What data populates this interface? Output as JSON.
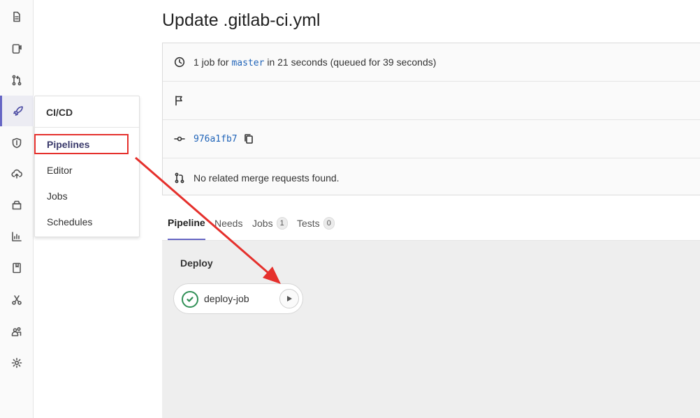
{
  "sidebar": {
    "icons": [
      {
        "name": "project-overview-icon",
        "label": ""
      },
      {
        "name": "issues-icon",
        "label": ""
      },
      {
        "name": "merge-requests-icon",
        "label": ""
      },
      {
        "name": "cicd-rocket-icon",
        "label": ""
      },
      {
        "name": "security-shield-icon",
        "label": ""
      },
      {
        "name": "deployments-icon",
        "label": ""
      },
      {
        "name": "packages-icon",
        "label": ""
      },
      {
        "name": "analytics-icon",
        "label": ""
      },
      {
        "name": "wiki-icon",
        "label": ""
      },
      {
        "name": "snippets-icon",
        "label": ""
      },
      {
        "name": "members-icon",
        "label": ""
      },
      {
        "name": "settings-gear-icon",
        "label": ""
      }
    ],
    "active": "cicd-rocket-icon"
  },
  "flyout": {
    "title": "CI/CD",
    "items": [
      "Pipelines",
      "Editor",
      "Jobs",
      "Schedules"
    ],
    "active_item": "Pipelines"
  },
  "page": {
    "title": "Update .gitlab-ci.yml"
  },
  "info": {
    "job_prefix": "1 job for",
    "branch": "master",
    "job_suffix": "in 21 seconds (queued for 39 seconds)",
    "commit_sha": "976a1fb7",
    "merge_requests": "No related merge requests found."
  },
  "tabs": [
    {
      "label": "Pipeline",
      "count": null,
      "active": true
    },
    {
      "label": "Needs",
      "count": null,
      "active": false
    },
    {
      "label": "Jobs",
      "count": "1",
      "active": false
    },
    {
      "label": "Tests",
      "count": "0",
      "active": false
    }
  ],
  "pipeline": {
    "stage": "Deploy",
    "job": {
      "name": "deploy-job",
      "status": "passed",
      "action": "play"
    }
  },
  "colors": {
    "accent": "#6666c4",
    "annotation": "#e5302c",
    "success": "#2f8f55",
    "link": "#1f63b8"
  }
}
